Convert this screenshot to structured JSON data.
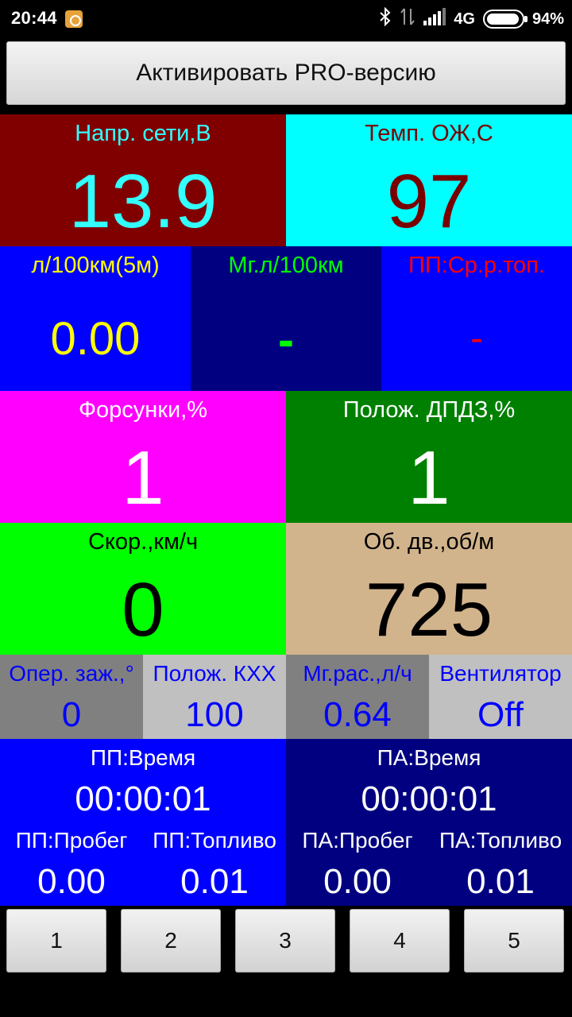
{
  "status": {
    "time": "20:44",
    "network": "4G",
    "battery": "94%"
  },
  "pro_button": "Активировать PRO-версию",
  "tiles": {
    "voltage": {
      "label": "Напр. сети,В",
      "value": "13.9",
      "bg": "#800000",
      "label_color": "#33ffff",
      "value_color": "#33ffff"
    },
    "coolant": {
      "label": "Темп. ОЖ,С",
      "value": "97",
      "bg": "#00ffff",
      "label_color": "#7a0000",
      "value_color": "#7a0000"
    },
    "fuel5m": {
      "label": "л/100км(5м)",
      "value": "0.00",
      "bg": "#0000ff",
      "label_color": "#ffff00",
      "value_color": "#ffff00"
    },
    "inst_fuel": {
      "label": "Мг.л/100км",
      "value": "-",
      "bg": "#000080",
      "label_color": "#00ff00",
      "value_color": "#00ff00"
    },
    "trip_avg": {
      "label": "ПП:Ср.р.топ.",
      "value": "-",
      "bg": "#0000ff",
      "label_color": "#ff0000",
      "value_color": "#ff0000"
    },
    "injectors": {
      "label": "Форсунки,%",
      "value": "1",
      "bg": "#ff00ff",
      "label_color": "#ffffff",
      "value_color": "#ffffff"
    },
    "throttle": {
      "label": "Полож. ДПДЗ,%",
      "value": "1",
      "bg": "#008000",
      "label_color": "#ffffff",
      "value_color": "#ffffff"
    },
    "speed": {
      "label": "Скор.,км/ч",
      "value": "0",
      "bg": "#00ff00",
      "label_color": "#000000",
      "value_color": "#000000"
    },
    "rpm": {
      "label": "Об. дв.,об/м",
      "value": "725",
      "bg": "#d2b48c",
      "label_color": "#000000",
      "value_color": "#000000"
    },
    "timing": {
      "label": "Опер. заж.,°",
      "value": "0",
      "bg": "#808080",
      "label_color": "#0000ff",
      "value_color": "#0000ff"
    },
    "idle_valve": {
      "label": "Полож. КХХ",
      "value": "100",
      "bg": "#c0c0c0",
      "label_color": "#0000ff",
      "value_color": "#0000ff"
    },
    "inst_consumption": {
      "label": "Мг.рас.,л/ч",
      "value": "0.64",
      "bg": "#808080",
      "label_color": "#0000ff",
      "value_color": "#0000ff"
    },
    "fan": {
      "label": "Вентилятор",
      "value": "Off",
      "bg": "#c0c0c0",
      "label_color": "#0000ff",
      "value_color": "#0000ff"
    }
  },
  "trip_pp": {
    "bg": "#0000ff",
    "time_label": "ПП:Время",
    "time_value": "00:00:01",
    "mileage_label": "ПП:Пробег",
    "mileage_value": "0.00",
    "fuel_label": "ПП:Топливо",
    "fuel_value": "0.01"
  },
  "trip_pa": {
    "bg": "#000080",
    "time_label": "ПА:Время",
    "time_value": "00:00:01",
    "mileage_label": "ПА:Пробег",
    "mileage_value": "0.00",
    "fuel_label": "ПА:Топливо",
    "fuel_value": "0.01"
  },
  "page_buttons": [
    "1",
    "2",
    "3",
    "4",
    "5"
  ]
}
